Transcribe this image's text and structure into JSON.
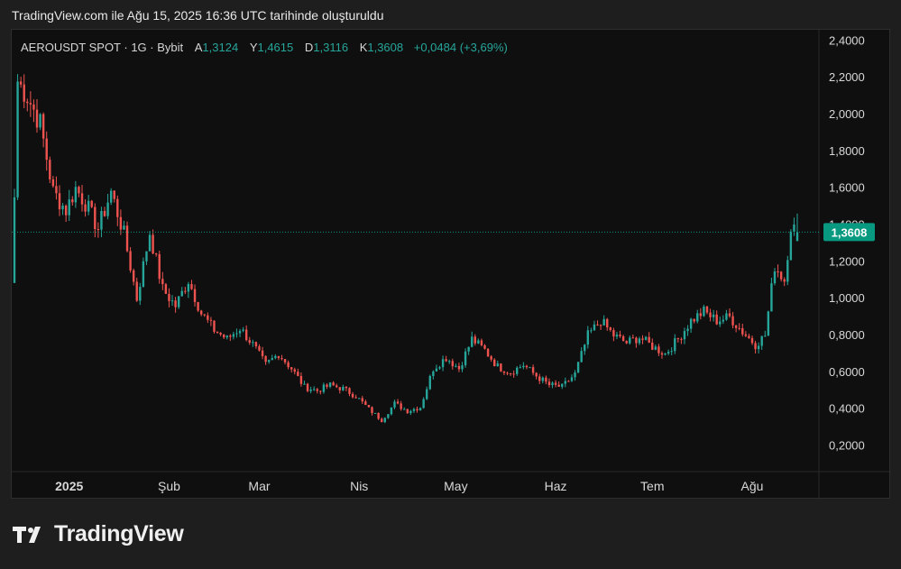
{
  "header": {
    "title": "TradingView.com ile Ağu 15, 2025 16:36 UTC tarihinde oluşturuldu"
  },
  "legend": {
    "symbol": "AEROUSDT SPOT · 1G · Bybit",
    "open_label": "A",
    "open": "1,3124",
    "high_label": "Y",
    "high": "1,4615",
    "low_label": "D",
    "low": "1,3116",
    "close_label": "K",
    "close": "1,3608",
    "change": "+0,0484 (+3,69%)"
  },
  "brand": {
    "name": "TradingView"
  },
  "colors": {
    "up": "#26a69a",
    "down": "#ef5350",
    "price_tag": "#089981"
  },
  "chart_data": {
    "type": "candlestick",
    "title": "AEROUSDT SPOT · 1G · Bybit",
    "yaxis": {
      "ticks": [
        "2,4000",
        "2,2000",
        "2,0000",
        "1,8000",
        "1,6000",
        "1,4000",
        "1,2000",
        "1,0000",
        "0,8000",
        "0,6000",
        "0,4000",
        "0,2000"
      ],
      "range": [
        0.06,
        2.46
      ]
    },
    "xaxis": {
      "ticks": [
        "2025",
        "Şub",
        "Mar",
        "Nis",
        "May",
        "Haz",
        "Tem",
        "Ağu"
      ]
    },
    "last_price": {
      "label": "1,3608",
      "value": 1.3608
    },
    "close_path": [
      [
        "Dec 15",
        1.55
      ],
      [
        "Dec 16",
        2.18
      ],
      [
        "Dec 19",
        2.1
      ],
      [
        "Dec 23",
        1.95
      ],
      [
        "Dec 27",
        1.58
      ],
      [
        "Dec 31",
        1.48
      ],
      [
        "Jan 3",
        1.6
      ],
      [
        "Jan 6",
        1.52
      ],
      [
        "Jan 10",
        1.38
      ],
      [
        "Jan 14",
        1.58
      ],
      [
        "Jan 18",
        1.35
      ],
      [
        "Jan 22",
        1.0
      ],
      [
        "Jan 26",
        1.36
      ],
      [
        "Jan 30",
        1.05
      ],
      [
        "Feb 3",
        0.96
      ],
      [
        "Feb 7",
        1.1
      ],
      [
        "Feb 11",
        0.92
      ],
      [
        "Feb 15",
        0.83
      ],
      [
        "Feb 19",
        0.78
      ],
      [
        "Feb 23",
        0.84
      ],
      [
        "Feb 27",
        0.75
      ],
      [
        "Mar 3",
        0.64
      ],
      [
        "Mar 7",
        0.7
      ],
      [
        "Mar 11",
        0.62
      ],
      [
        "Mar 15",
        0.52
      ],
      [
        "Mar 19",
        0.5
      ],
      [
        "Mar 23",
        0.53
      ],
      [
        "Mar 27",
        0.51
      ],
      [
        "Mar 31",
        0.47
      ],
      [
        "Apr 4",
        0.4
      ],
      [
        "Apr 8",
        0.34
      ],
      [
        "Apr 12",
        0.43
      ],
      [
        "Apr 16",
        0.39
      ],
      [
        "Apr 20",
        0.41
      ],
      [
        "Apr 24",
        0.62
      ],
      [
        "Apr 28",
        0.68
      ],
      [
        "May 2",
        0.62
      ],
      [
        "May 6",
        0.78
      ],
      [
        "May 10",
        0.72
      ],
      [
        "May 14",
        0.63
      ],
      [
        "May 18",
        0.6
      ],
      [
        "May 22",
        0.64
      ],
      [
        "May 26",
        0.58
      ],
      [
        "May 30",
        0.53
      ],
      [
        "Jun 3",
        0.52
      ],
      [
        "Jun 7",
        0.59
      ],
      [
        "Jun 11",
        0.8
      ],
      [
        "Jun 15",
        0.88
      ],
      [
        "Jun 19",
        0.8
      ],
      [
        "Jun 23",
        0.76
      ],
      [
        "Jun 27",
        0.79
      ],
      [
        "Jul 1",
        0.74
      ],
      [
        "Jul 5",
        0.7
      ],
      [
        "Jul 9",
        0.78
      ],
      [
        "Jul 13",
        0.88
      ],
      [
        "Jul 17",
        0.93
      ],
      [
        "Jul 21",
        0.88
      ],
      [
        "Jul 25",
        0.9
      ],
      [
        "Jul 29",
        0.82
      ],
      [
        "Aug 2",
        0.75
      ],
      [
        "Aug 5",
        0.8
      ],
      [
        "Aug 8",
        1.18
      ],
      [
        "Aug 11",
        1.1
      ],
      [
        "Aug 13",
        1.4
      ],
      [
        "Aug 15",
        1.36
      ]
    ]
  }
}
